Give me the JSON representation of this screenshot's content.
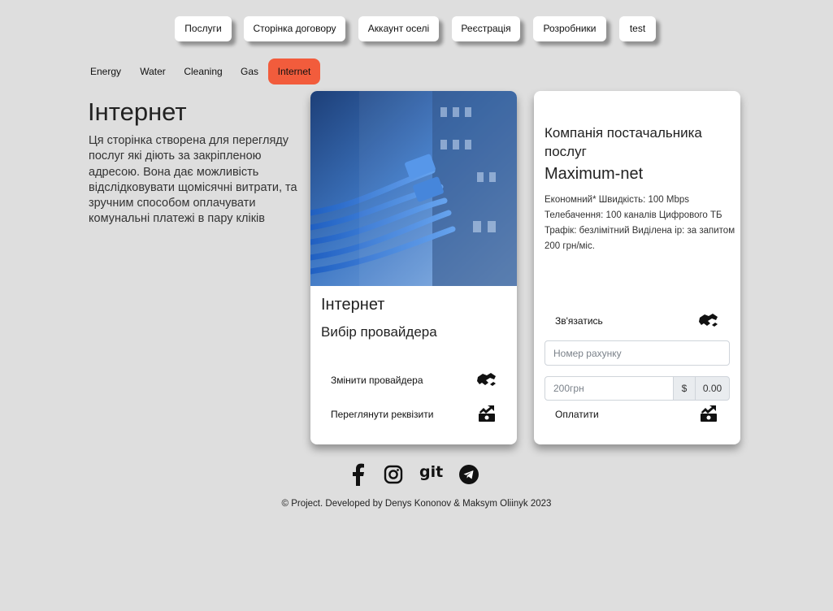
{
  "nav": {
    "items": [
      "Послуги",
      "Сторінка договору",
      "Аккаунт оселі",
      "Реєстрація",
      "Розробники",
      "test"
    ]
  },
  "tabs": {
    "items": [
      "Energy",
      "Water",
      "Cleaning",
      "Gas",
      "Internet"
    ],
    "active": "Internet",
    "active_color": "#f25c3c"
  },
  "intro": {
    "title": "Інтернет",
    "text": "Ця сторінка створена для перегляду послуг які діють за закріпленою адресою. Вона дає можливість відслідковувати щомісячні витрати, та зручним способом оплачувати комунальні платежі в пару кліків"
  },
  "service_card": {
    "image": "network-cables-image",
    "title": "Інтернет",
    "subtitle": "Вибір провайдера",
    "change_provider_label": "Змінити провайдера",
    "change_provider_icon": "handshake-icon",
    "view_details_label": "Переглянути реквізити",
    "view_details_icon": "money-bill-trend-up-icon"
  },
  "provider_card": {
    "heading": "Компанія постачальника послуг",
    "name": "Maximum-net",
    "description": "Економний* Швидкість: 100 Mbps Телебачення: 100 каналів Цифрового ТБ Трафік: безлімітний Виділена ip: за запитом 200 грн/міс.",
    "contact_label": "Зв'язатись",
    "contact_icon": "handshake-icon",
    "account_placeholder": "Номер рахунку",
    "amount_placeholder": "200грн",
    "currency_symbol": "$",
    "amount_value": "0.00",
    "pay_label": "Оплатити",
    "pay_icon": "money-bill-trend-up-icon"
  },
  "socials": {
    "items": [
      "facebook-icon",
      "instagram-icon",
      "git-icon",
      "telegram-icon"
    ],
    "git_text": "git"
  },
  "footer": {
    "text": "© Project. Developed by Denys Kononov & Maksym Oliinyk 2023"
  }
}
